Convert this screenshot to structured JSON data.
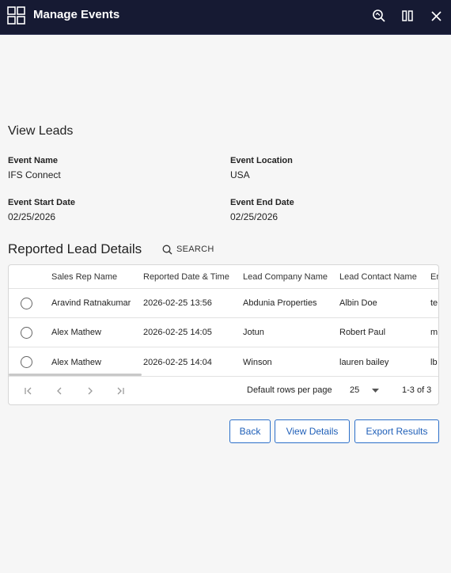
{
  "window": {
    "title": "Manage Events"
  },
  "view": {
    "title": "View Leads",
    "event_name_label": "Event Name",
    "event_name": "IFS Connect",
    "event_location_label": "Event Location",
    "event_location": "USA",
    "event_start_label": "Event Start Date",
    "event_start": "02/25/2026",
    "event_end_label": "Event End Date",
    "event_end": "02/25/2026"
  },
  "leads": {
    "title": "Reported Lead Details",
    "search_label": "SEARCH",
    "columns": [
      "Sales Rep Name",
      "Reported Date & Time",
      "Lead Company Name",
      "Lead Contact Name",
      "Em"
    ],
    "rows": [
      [
        "Aravind Ratnakumar",
        "2026-02-25 13:56",
        "Abdunia Properties",
        "Albin Doe",
        "te"
      ],
      [
        "Alex Mathew",
        "2026-02-25 14:05",
        "Jotun",
        "Robert Paul",
        "m"
      ],
      [
        "Alex Mathew",
        "2026-02-25 14:04",
        "Winson",
        "lauren bailey",
        "lb"
      ]
    ],
    "pager": {
      "rows_per_page_label": "Default rows per page",
      "rows_per_page": "25",
      "range": "1-3 of 3"
    }
  },
  "actions": {
    "back": "Back",
    "view_details": "View Details",
    "export_results": "Export Results"
  },
  "icons": {
    "app": "grid-apps-icon",
    "inspect": "zoom-inspect-icon",
    "split": "split-view-icon",
    "close": "close-icon",
    "search": "search-icon",
    "first": "first-page-icon",
    "prev": "prev-page-icon",
    "next": "next-page-icon",
    "last": "last-page-icon",
    "dropdown": "caret-down-icon"
  },
  "colors": {
    "titlebar": "#161a33",
    "accent": "#2b6fc9"
  }
}
